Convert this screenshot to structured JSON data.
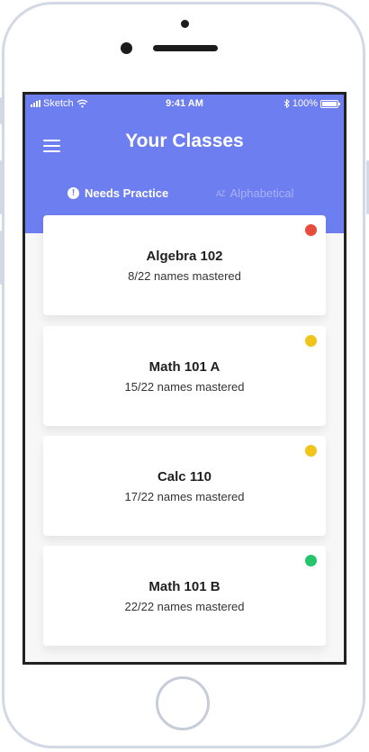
{
  "status_bar": {
    "carrier": "Sketch",
    "time": "9:41 AM",
    "battery": "100%"
  },
  "header": {
    "title": "Your Classes"
  },
  "tabs": [
    {
      "label": "Needs Practice",
      "icon": "alert-circle-icon",
      "active": true
    },
    {
      "label": "Alphabetical",
      "icon": "az-sort-icon",
      "active": false
    }
  ],
  "classes": [
    {
      "name": "Algebra 102",
      "progress_text": "8/22 names mastered",
      "status_color": "#e94b3c"
    },
    {
      "name": "Math 101 A",
      "progress_text": "15/22 names mastered",
      "status_color": "#f0c419"
    },
    {
      "name": "Calc 110",
      "progress_text": "17/22 names mastered",
      "status_color": "#f0c419"
    },
    {
      "name": "Math 101 B",
      "progress_text": "22/22 names mastered",
      "status_color": "#27c56a"
    }
  ],
  "colors": {
    "header": "#6d7ef0",
    "frame": "#d3d9e4"
  }
}
